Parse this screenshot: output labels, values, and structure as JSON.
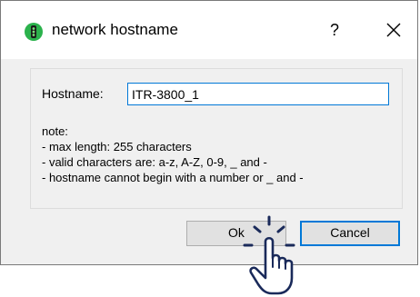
{
  "window": {
    "title": "network hostname",
    "help_glyph": "?",
    "icons": [
      "app-traffic-light-icon",
      "close-icon",
      "hand-pointer-cursor-icon"
    ]
  },
  "form": {
    "hostname_label": "Hostname:",
    "hostname_value": "ITR-3800_1"
  },
  "note": {
    "heading": "note:",
    "lines": [
      "- max length: 255 characters",
      "- valid characters are: a-z, A-Z, 0-9, _ and -",
      "- hostname cannot begin with a number or _ and -"
    ]
  },
  "buttons": {
    "ok_label": "Ok",
    "cancel_label": "Cancel"
  },
  "colors": {
    "accent": "#0078d7",
    "dialog_bg": "#f0f0f0",
    "icon_green": "#2bb24c"
  }
}
